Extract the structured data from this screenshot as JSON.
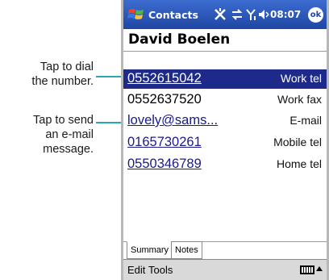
{
  "callouts": {
    "dial": [
      "Tap to dial",
      "the number."
    ],
    "email": [
      "Tap to send",
      "an e-mail",
      "message."
    ]
  },
  "titlebar": {
    "app_title": "Contacts",
    "time": "08:07",
    "ok_label": "ok"
  },
  "contact": {
    "name": "David Boelen",
    "fields": [
      {
        "value": "0552615042",
        "type": "Work tel",
        "selected": true,
        "link": true
      },
      {
        "value": "0552637520",
        "type": "Work fax",
        "selected": false,
        "link": false
      },
      {
        "value": "lovely@sams...",
        "type": "E-mail",
        "selected": false,
        "link": true
      },
      {
        "value": "0165730261",
        "type": "Mobile tel",
        "selected": false,
        "link": true
      },
      {
        "value": "0550346789",
        "type": "Home tel",
        "selected": false,
        "link": true
      }
    ]
  },
  "tabs": [
    "Summary",
    "Notes"
  ],
  "menu": {
    "edit": "Edit",
    "tools": "Tools"
  },
  "colors": {
    "titlebar": "#1f46a4",
    "selection": "#1d2a8a",
    "callout_line": "#2aa7b5"
  }
}
